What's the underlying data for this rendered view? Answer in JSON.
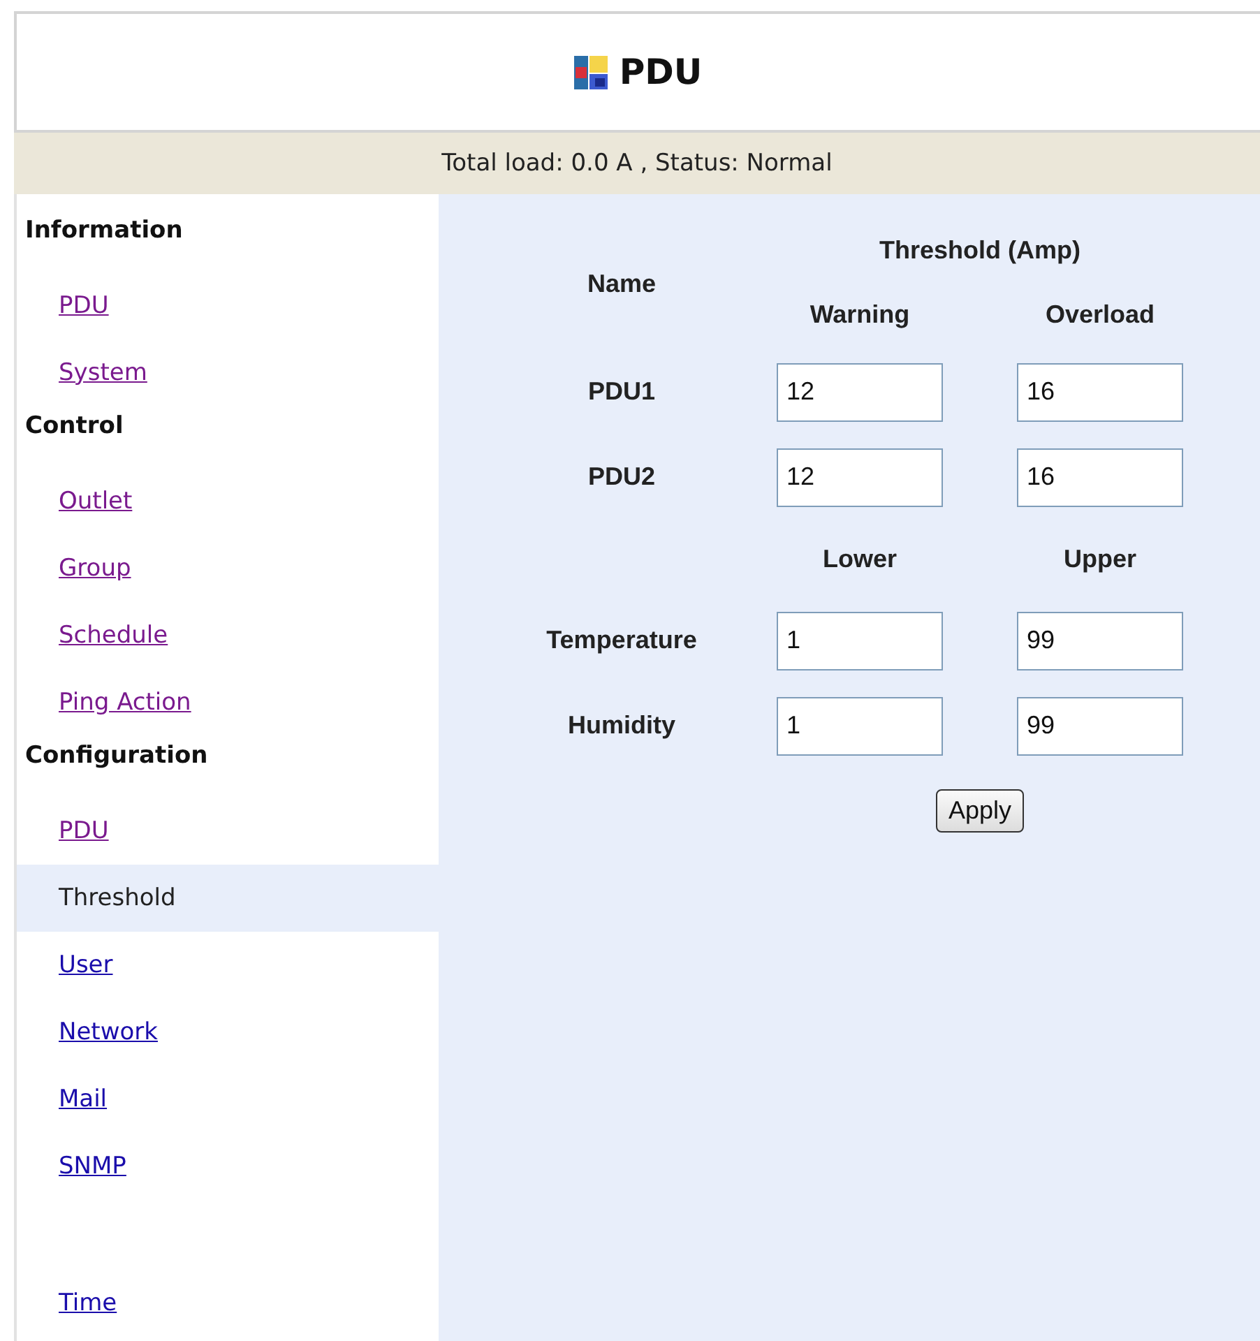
{
  "header": {
    "title": "PDU"
  },
  "status_bar": "Total load: 0.0 A , Status: Normal",
  "sidebar": {
    "sections": [
      {
        "heading": "Information",
        "items": [
          {
            "label": "PDU",
            "visited": true,
            "selected": false
          },
          {
            "label": "System",
            "visited": true,
            "selected": false
          }
        ]
      },
      {
        "heading": "Control",
        "items": [
          {
            "label": "Outlet",
            "visited": true,
            "selected": false
          },
          {
            "label": "Group",
            "visited": true,
            "selected": false
          },
          {
            "label": "Schedule",
            "visited": true,
            "selected": false
          },
          {
            "label": "Ping Action",
            "visited": true,
            "selected": false
          }
        ]
      },
      {
        "heading": "Configuration",
        "items": [
          {
            "label": "PDU",
            "visited": true,
            "selected": false
          },
          {
            "label": "Threshold",
            "selected": true
          },
          {
            "label": "User",
            "visited": false,
            "selected": false
          },
          {
            "label": "Network",
            "visited": false,
            "selected": false
          },
          {
            "label": "Mail",
            "visited": false,
            "selected": false
          },
          {
            "label": "SNMP",
            "visited": false,
            "selected": false
          },
          {
            "label": "Time",
            "visited": false,
            "selected": false,
            "gap_before": true
          }
        ]
      }
    ]
  },
  "form": {
    "name_header": "Name",
    "group_header": "Threshold (Amp)",
    "blocks": [
      {
        "columns": [
          "Warning",
          "Overload"
        ],
        "rows": [
          {
            "name": "PDU1",
            "values": [
              "12",
              "16"
            ]
          },
          {
            "name": "PDU2",
            "values": [
              "12",
              "16"
            ]
          }
        ]
      },
      {
        "columns": [
          "Lower",
          "Upper"
        ],
        "rows": [
          {
            "name": "Temperature",
            "values": [
              "1",
              "99"
            ]
          },
          {
            "name": "Humidity",
            "values": [
              "1",
              "99"
            ]
          }
        ]
      }
    ],
    "apply_button": "Apply"
  }
}
